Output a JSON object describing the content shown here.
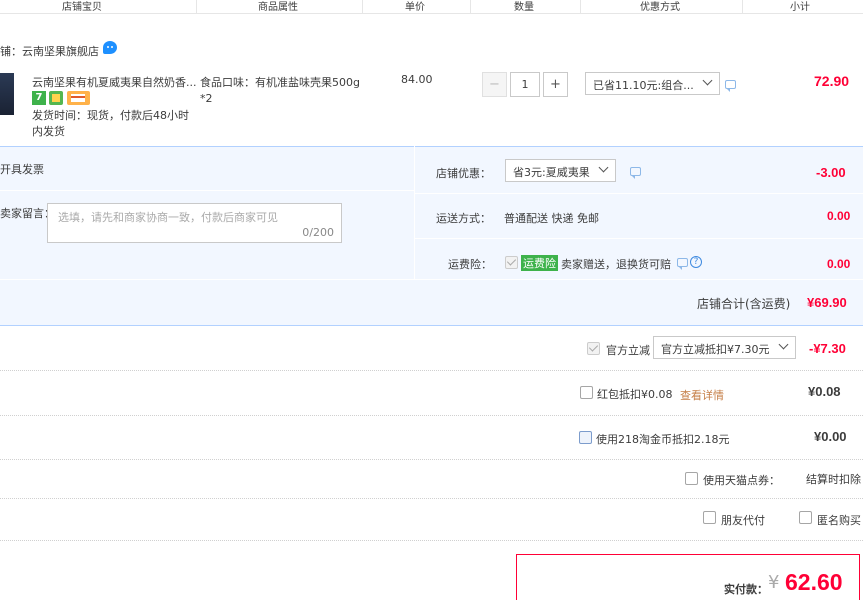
{
  "header": {
    "col_item": "店铺宝贝",
    "col_attr": "商品属性",
    "col_price": "单价",
    "col_qty": "数量",
    "col_promo": "优惠方式",
    "col_subtotal": "小计"
  },
  "shop": {
    "label": "铺：云南坚果旗舰店",
    "badge_icon": "chat-bubble-icon"
  },
  "item": {
    "title": "云南坚果有机夏威夷果自然奶香...",
    "badge_7": "7",
    "delivery": "发货时间：现货，付款后48小时",
    "delivery2": "内发货",
    "attr": "食品口味：有机准盐味壳果500g",
    "attr2": "*2",
    "price": "84.00",
    "qty": "1",
    "qty_minus": "−",
    "qty_plus": "+",
    "promo_select": "已省11.10元:组合...",
    "subtotal": "72.90"
  },
  "invoice": {
    "label": "开具发票"
  },
  "message": {
    "label": "卖家留言：",
    "placeholder": "选填，请先和商家协商一致，付款后商家可见",
    "counter": "0/200"
  },
  "shop_discount": {
    "label": "店铺优惠：",
    "select": "省3元:夏威夷果",
    "amount": "-3.00"
  },
  "shipping": {
    "label": "运送方式：",
    "value": "普通配送 快递 免邮",
    "amount": "0.00"
  },
  "insurance": {
    "label": "运费险：",
    "tag": "运费险",
    "desc": "卖家赠送，退换货可赔",
    "amount": "0.00"
  },
  "shop_total": {
    "label": "店铺合计(含运费)",
    "amount": "¥69.90"
  },
  "official_discount": {
    "label": "官方立减",
    "select": "官方立减抵扣¥7.30元",
    "amount": "-¥7.30"
  },
  "red_packet": {
    "label": "红包抵扣¥0.08",
    "link": "查看详情",
    "amount": "¥0.08"
  },
  "taobao_coins": {
    "label": "使用218淘金币抵扣2.18元",
    "amount": "¥0.00"
  },
  "tmall_points": {
    "label": "使用天猫点券：",
    "value": "结算时扣除"
  },
  "options": {
    "friend_pay": "朋友代付",
    "anonymous": "匿名购买"
  },
  "payment": {
    "label": "实付款：",
    "currency": "¥",
    "amount": "62.60"
  },
  "colors": {
    "price_red": "#ff0036",
    "panel_blue": "#f2f7ff",
    "tag_green": "#3eb24b"
  }
}
